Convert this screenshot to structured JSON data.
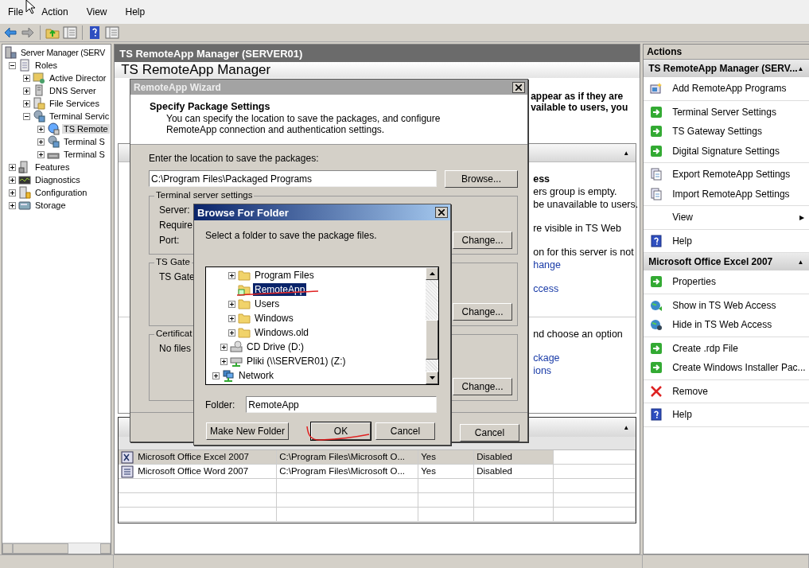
{
  "menu": [
    "File",
    "Action",
    "View",
    "Help"
  ],
  "toolbar": [
    {
      "kind": "back"
    },
    {
      "kind": "forward"
    },
    {
      "kind": "up"
    },
    {
      "kind": "pane"
    },
    {
      "kind": "help"
    },
    {
      "kind": "pane"
    }
  ],
  "tree": [
    {
      "label": "Server Manager (SERV",
      "kind": "server",
      "expander": false,
      "selected": false,
      "children": [
        {
          "label": "Roles",
          "kind": "roles",
          "expander": true,
          "expanded": true,
          "selected": false,
          "children": [
            {
              "label": "Active Director",
              "kind": "ad",
              "expander": true,
              "expanded": false,
              "selected": false
            },
            {
              "label": "DNS Server",
              "kind": "dns",
              "expander": true,
              "expanded": false,
              "selected": false
            },
            {
              "label": "File Services",
              "kind": "files",
              "expander": true,
              "expanded": false,
              "selected": false
            },
            {
              "label": "Terminal Servic",
              "kind": "ts",
              "expander": true,
              "expanded": true,
              "selected": false,
              "children": [
                {
                  "label": "TS Remote",
                  "kind": "remote",
                  "expander": true,
                  "expanded": false,
                  "selected": true
                },
                {
                  "label": "Terminal S",
                  "kind": "ts",
                  "expander": true,
                  "expanded": false,
                  "selected": false
                },
                {
                  "label": "Terminal S",
                  "kind": "gw",
                  "expander": true,
                  "expanded": false,
                  "selected": false
                }
              ]
            }
          ]
        },
        {
          "label": "Features",
          "kind": "features",
          "expander": true,
          "expanded": false,
          "selected": false
        },
        {
          "label": "Diagnostics",
          "kind": "diag",
          "expander": true,
          "expanded": false,
          "selected": false
        },
        {
          "label": "Configuration",
          "kind": "config",
          "expander": true,
          "expanded": false,
          "selected": false
        },
        {
          "label": "Storage",
          "kind": "storage",
          "expander": true,
          "expanded": false,
          "selected": false
        }
      ]
    }
  ],
  "center": {
    "header": "TS RemoteApp Manager (SERVER01)",
    "title": "TS RemoteApp Manager",
    "intro": [
      "appear as if they are",
      "vailable to users, you"
    ],
    "panel": {
      "collapse": "▲",
      "sections": [
        [
          [
            {
              "kind": "bold",
              "text": "ess"
            },
            {
              "kind": "text",
              "text": "ers group is empty."
            },
            {
              "kind": "text",
              "text": "be unavailable to users."
            }
          ],
          [
            {
              "kind": "text",
              "text": "re visible in TS Web"
            }
          ],
          [
            {
              "kind": "text",
              "text": "on for this server is not"
            },
            {
              "kind": "link",
              "text": "hange"
            }
          ],
          [
            {
              "kind": "link",
              "text": "ccess"
            }
          ]
        ],
        [
          [
            {
              "kind": "text",
              "text": "nd choose an option"
            }
          ],
          [
            {
              "kind": "link",
              "text": "ckage"
            },
            {
              "kind": "link",
              "text": "ions"
            }
          ]
        ]
      ]
    },
    "table": {
      "collapse": "▲",
      "rows": [
        {
          "kind": "excel",
          "selected": true,
          "cells": [
            "Microsoft Office Excel 2007",
            "C:\\Program Files\\Microsoft O...",
            "Yes",
            "Disabled"
          ]
        },
        {
          "kind": "word",
          "selected": false,
          "cells": [
            "Microsoft Office Word 2007",
            "C:\\Program Files\\Microsoft O...",
            "Yes",
            "Disabled"
          ]
        }
      ]
    }
  },
  "actions": {
    "title": "Actions",
    "sections": [
      {
        "title": "TS RemoteApp Manager (SERV...",
        "collapse": "▲",
        "groups": [
          [
            {
              "label": "Add RemoteApp Programs",
              "kind": "add"
            }
          ],
          [
            {
              "label": "Terminal Server Settings",
              "kind": "go"
            },
            {
              "label": "TS Gateway Settings",
              "kind": "go"
            },
            {
              "label": "Digital Signature Settings",
              "kind": "go"
            }
          ],
          [
            {
              "label": "Export RemoteApp Settings",
              "kind": "export"
            },
            {
              "label": "Import RemoteApp Settings",
              "kind": "export"
            }
          ],
          [
            {
              "label": "View",
              "kind": "submenu",
              "submenu": "▶"
            }
          ],
          [
            {
              "label": "Help",
              "kind": "help"
            }
          ]
        ]
      },
      {
        "title": "Microsoft Office Excel 2007",
        "collapse": "▲",
        "groups": [
          [
            {
              "label": "Properties",
              "kind": "go"
            }
          ],
          [
            {
              "label": "Show in TS Web Access",
              "kind": "globe-show"
            },
            {
              "label": "Hide in TS Web Access",
              "kind": "globe-hide"
            }
          ],
          [
            {
              "label": "Create .rdp File",
              "kind": "go"
            },
            {
              "label": "Create Windows Installer Pac...",
              "kind": "go"
            }
          ],
          [
            {
              "label": "Remove",
              "kind": "remove"
            }
          ],
          [
            {
              "label": "Help",
              "kind": "help"
            }
          ]
        ]
      }
    ]
  },
  "wizard": {
    "title": "RemoteApp Wizard",
    "heading": "Specify Package Settings",
    "description": "You can specify the location to save the packages, and configure RemoteApp connection and authentication settings.",
    "location_label": "Enter the location to save the packages:",
    "location": "C:\\Program Files\\Packaged Programs",
    "browse": "Browse...",
    "groups": [
      {
        "legend": "Terminal server settings",
        "lines": [
          "Server:",
          "Require",
          "Port:"
        ],
        "button": "Change..."
      },
      {
        "legend": "TS Gate",
        "lines": [
          "TS Gate"
        ],
        "button": "Change..."
      },
      {
        "legend": "Certificat",
        "lines": [
          "No files"
        ],
        "button": "Change..."
      }
    ],
    "cancel": "Cancel"
  },
  "browse": {
    "title": "Browse For Folder",
    "prompt": "Select a folder to save the package files.",
    "tree": [
      {
        "children": [
          {
            "children": [
              {
                "label": "Program Files",
                "kind": "folder",
                "expander": true,
                "selected": false
              },
              {
                "label": "RemoteApp",
                "kind": "shared-folder",
                "expander": false,
                "selected": true
              },
              {
                "label": "Users",
                "kind": "folder",
                "expander": true,
                "selected": false
              },
              {
                "label": "Windows",
                "kind": "folder",
                "expander": true,
                "selected": false
              },
              {
                "label": "Windows.old",
                "kind": "folder",
                "expander": true,
                "selected": false
              }
            ]
          },
          {
            "label": "CD Drive (D:)",
            "kind": "cd",
            "expander": true,
            "selected": false
          },
          {
            "label": "Pliki (\\\\SERVER01) (Z:)",
            "kind": "netdrive",
            "expander": true,
            "selected": false
          }
        ]
      },
      {
        "label": "Network",
        "kind": "network",
        "expander": true,
        "selected": false
      }
    ],
    "folder_label": "Folder:",
    "folder": "RemoteApp",
    "buttons": [
      {
        "label": "Make New Folder",
        "default": false
      },
      {
        "label": "OK",
        "default": true
      },
      {
        "label": "Cancel",
        "default": false
      }
    ]
  }
}
